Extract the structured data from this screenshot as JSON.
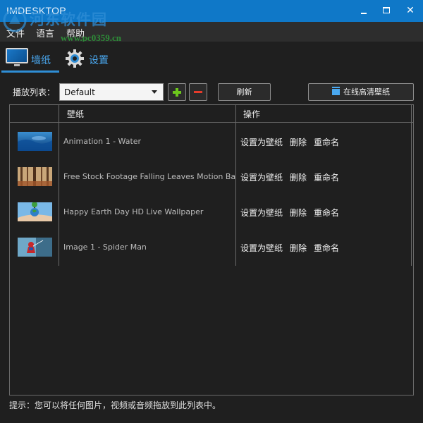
{
  "window": {
    "title": "IMDESKTOP",
    "watermark_text": "河东软件园",
    "watermark_url": "www.pc0359.cn"
  },
  "menu": {
    "items": [
      "文件",
      "语言",
      "帮助"
    ]
  },
  "tabs": [
    {
      "label": "墙纸",
      "icon": "monitor-icon",
      "active": true
    },
    {
      "label": "设置",
      "icon": "gear-icon",
      "active": false
    }
  ],
  "toolbar": {
    "playlist_label": "播放列表：",
    "playlist_value": "Default",
    "refresh_label": "刷新",
    "online_label": "在线高清壁纸"
  },
  "table": {
    "columns": [
      "壁纸",
      "操作"
    ],
    "actions": [
      "设置为壁纸",
      "删除",
      "重命名"
    ],
    "rows": [
      {
        "title": "Animation 1 - Water",
        "thumb": "water"
      },
      {
        "title": "Free Stock Footage Falling Leaves Motion Backgr",
        "thumb": "leaves"
      },
      {
        "title": "Happy Earth Day HD Live Wallpaper",
        "thumb": "earth"
      },
      {
        "title": "Image 1 - Spider Man",
        "thumb": "spiderman"
      }
    ]
  },
  "hint": "提示：您可以将任何图片，视频或音频拖放到此列表中。",
  "colors": {
    "titlebar": "#0f78c8",
    "accent": "#4aa8f0",
    "add": "#6cc61c",
    "remove": "#e53b2b",
    "background": "#1f1f1f"
  }
}
